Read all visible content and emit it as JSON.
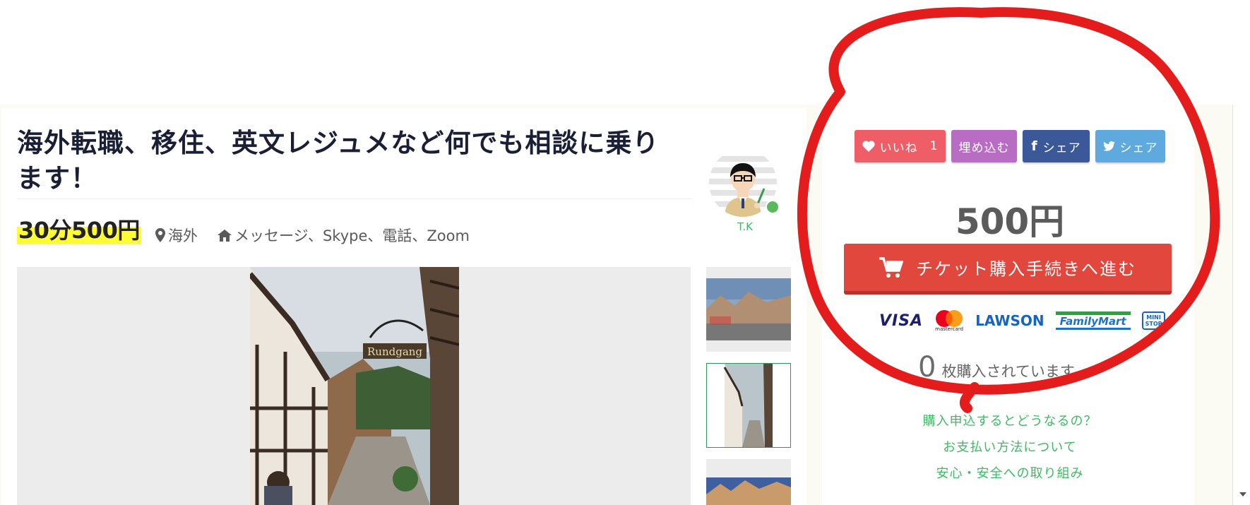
{
  "listing": {
    "title": "海外転職、移住、英文レジュメなど何でも相談に乗ります！",
    "price_label": "30分500円",
    "location": "海外",
    "methods": "メッセージ、Skype、電話、Zoom"
  },
  "author": {
    "name": "T.K",
    "online_color": "#5cb85c"
  },
  "share": {
    "like_label": "いいね",
    "like_count": "1",
    "embed_label": "埋め込む",
    "facebook_label": "シェア",
    "twitter_label": "シェア"
  },
  "purchase": {
    "price": "500円",
    "buy_label": "チケット購入手続きへ進む",
    "sold_count": "0",
    "sold_suffix": "枚購入されています"
  },
  "payments": {
    "visa": "VISA",
    "mastercard": "mastercard",
    "lawson": "LAWSON",
    "familymart": "FamilyMart",
    "ministop_line1": "MINI",
    "ministop_line2": "STOP"
  },
  "faq": {
    "q1": "購入申込するとどうなるの？",
    "q2": "お支払い方法について",
    "q3": "安心・安全への取り組み"
  },
  "colors": {
    "accent_green": "#3dbb64",
    "buy_red": "#e2473d",
    "highlight_yellow": "#fffb35",
    "annotation_red": "#e51c1c"
  },
  "icons": {
    "location": "map-marker-icon",
    "home": "home-icon",
    "heart": "heart-icon",
    "facebook": "facebook-icon",
    "twitter": "twitter-icon",
    "cart": "cart-icon"
  }
}
